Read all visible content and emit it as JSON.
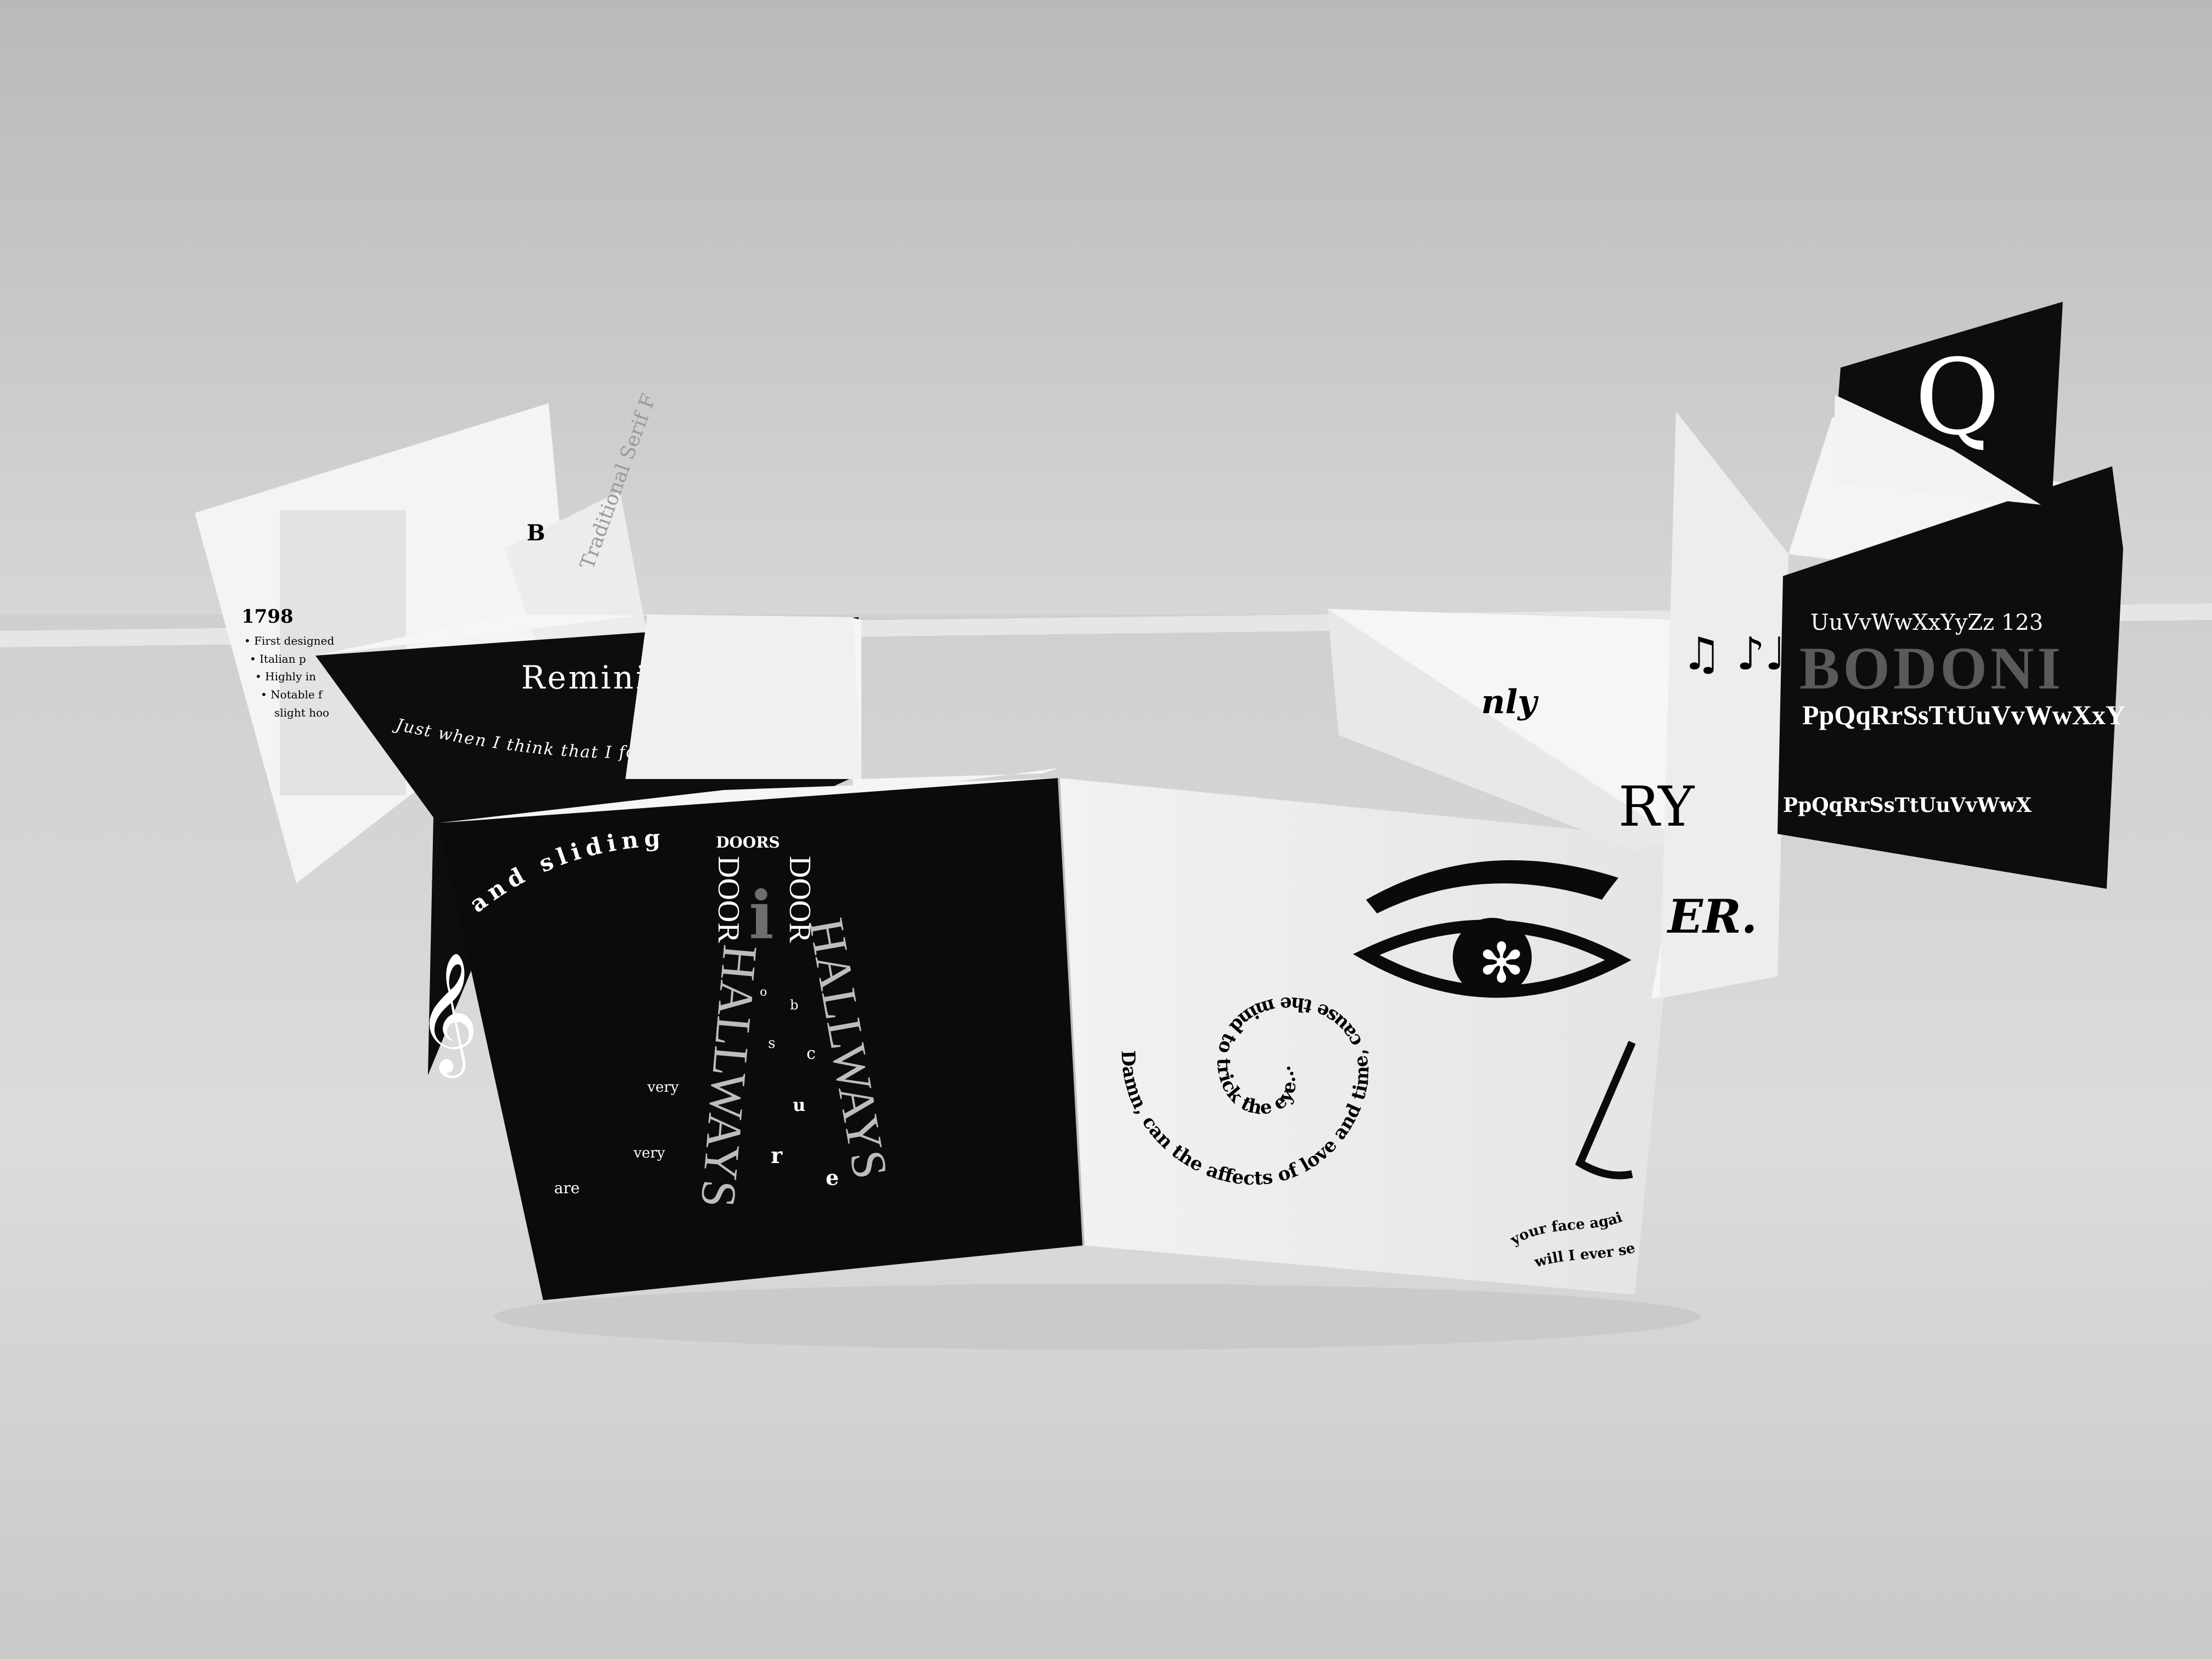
{
  "brochure": {
    "far_left": {
      "year": "1798",
      "bullets": [
        "• First designed",
        "• Italian p",
        "• Highly in",
        "• Notable f",
        "slight hoo"
      ],
      "spine_text": "Traditional Serif F",
      "partial_letter": "B"
    },
    "reminisce_panel": {
      "title": "Reminisce...",
      "arc_text": "Just when I think that I for",
      "clef": "𝄞"
    },
    "hallways_panel": {
      "arc_text": "and sliding",
      "doors_label": "DOORS",
      "left_column": "DOOR",
      "right_column": "DOOR",
      "center_letter": "i",
      "left_hallway": "HALLWAYS",
      "right_hallway": "HALLWAYS",
      "scattered": [
        "o",
        "b",
        "s",
        "c",
        "u",
        "r",
        "e"
      ],
      "very_1": "very",
      "very_2": "very",
      "are": "are"
    },
    "eye_panel": {
      "spiral_text": "Damn, can the affects of love and time, cause the mind to trick the eye...",
      "wavy_text_top": "your face again",
      "wavy_text_bottom": "will I ever see"
    },
    "music_panel": {
      "notes": "♫ ♪♩",
      "partial_top": "nly",
      "partial_mid": "RY",
      "partial_bottom": "ER."
    },
    "alphabet_panel": {
      "row1": "UuVvWwXxYyZz 123",
      "row2": "PpQqRrSsTtUuVvWwXxY",
      "row3": "PpQqRrSsTtUuVvWwX",
      "ghost": "BODONI"
    },
    "far_right": {
      "letter": "Q"
    }
  }
}
